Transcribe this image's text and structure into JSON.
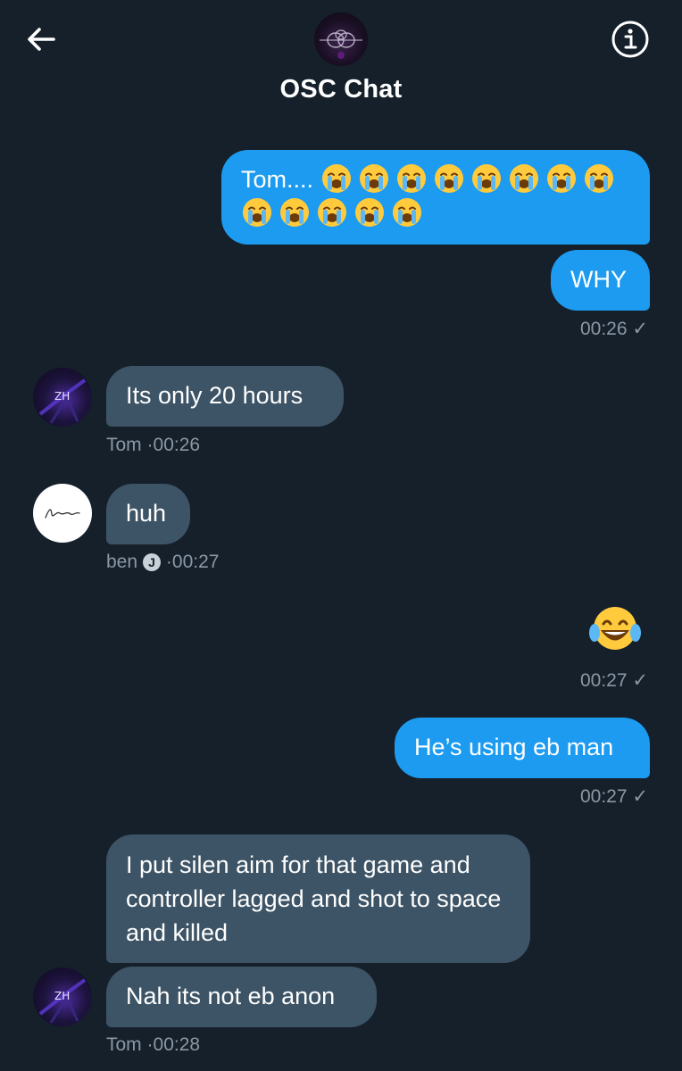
{
  "header": {
    "title": "OSC Chat",
    "back_icon": "arrow-left-icon",
    "info_icon": "info-icon"
  },
  "messages": [
    {
      "direction": "out",
      "text": "Tom....",
      "emoji": "loudly-crying-face",
      "emoji_count": 13
    },
    {
      "direction": "out",
      "text": "WHY",
      "time": "00:26",
      "status": "✓"
    },
    {
      "direction": "in",
      "sender": "Tom",
      "text": "Its only 20 hours",
      "time": "00:26"
    },
    {
      "direction": "in",
      "sender": "ben",
      "verified_badge": "J",
      "text": "huh",
      "time": "00:27"
    },
    {
      "direction": "out",
      "emoji": "face-with-tears-of-joy",
      "time": "00:27",
      "status": "✓"
    },
    {
      "direction": "out",
      "text": "He’s using eb man",
      "time": "00:27",
      "status": "✓"
    },
    {
      "direction": "in",
      "sender": "Tom",
      "text": "I put silen aim for that game and controller lagged and shot to space and killed"
    },
    {
      "direction": "in",
      "sender": "Tom",
      "text": "Nah its not eb anon",
      "time": "00:28"
    }
  ],
  "meta_separator": "·",
  "colors": {
    "background": "#15202b",
    "outgoing_bubble": "#1d9bf0",
    "incoming_bubble": "#3d5466",
    "meta_text": "#8b98a5"
  }
}
